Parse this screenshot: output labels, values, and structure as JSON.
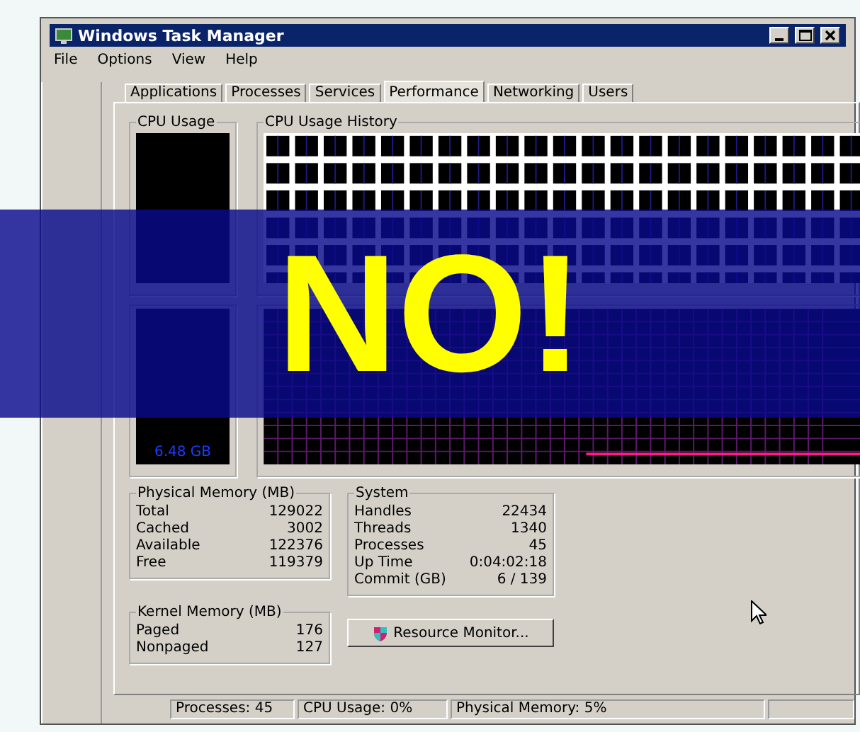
{
  "window": {
    "title": "Windows Task Manager"
  },
  "menu": [
    "File",
    "Options",
    "View",
    "Help"
  ],
  "tabs": [
    {
      "label": "Applications",
      "selected": false
    },
    {
      "label": "Processes",
      "selected": false
    },
    {
      "label": "Services",
      "selected": false
    },
    {
      "label": "Performance",
      "selected": true
    },
    {
      "label": "Networking",
      "selected": false
    },
    {
      "label": "Users",
      "selected": false
    }
  ],
  "cpu_usage": {
    "title": "CPU Usage"
  },
  "cpu_history": {
    "title": "CPU Usage History"
  },
  "memory": {
    "reading": "6.48 GB"
  },
  "physical_memory": {
    "title": "Physical Memory (MB)",
    "rows": [
      {
        "label": "Total",
        "value": "129022"
      },
      {
        "label": "Cached",
        "value": "3002"
      },
      {
        "label": "Available",
        "value": "122376"
      },
      {
        "label": "Free",
        "value": "119379"
      }
    ]
  },
  "kernel_memory": {
    "title": "Kernel Memory (MB)",
    "rows": [
      {
        "label": "Paged",
        "value": "176"
      },
      {
        "label": "Nonpaged",
        "value": "127"
      }
    ]
  },
  "system": {
    "title": "System",
    "rows": [
      {
        "label": "Handles",
        "value": "22434"
      },
      {
        "label": "Threads",
        "value": "1340"
      },
      {
        "label": "Processes",
        "value": "45"
      },
      {
        "label": "Up Time",
        "value": "0:04:02:18"
      },
      {
        "label": "Commit (GB)",
        "value": "6 / 139"
      }
    ]
  },
  "resource_monitor_button": "Resource Monitor...",
  "status_bar": [
    "Processes: 45",
    "CPU Usage: 0%",
    "Physical Memory: 5%"
  ],
  "overlay": {
    "text": "NO!"
  }
}
